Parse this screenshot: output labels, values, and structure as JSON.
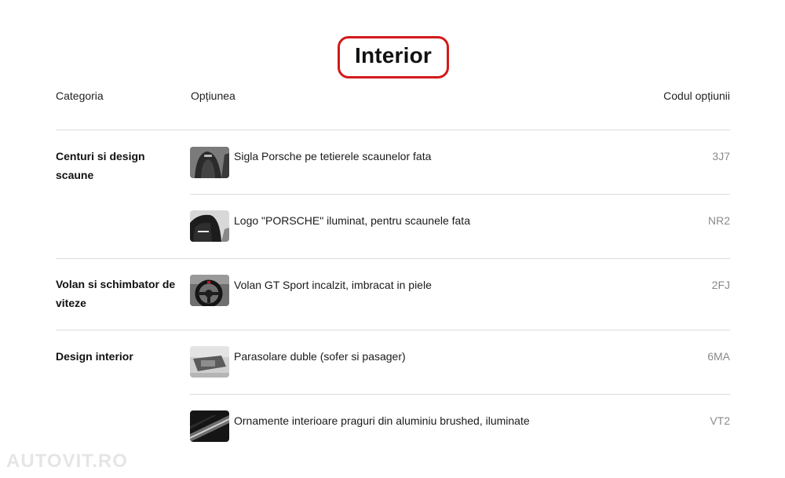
{
  "title": "Interior",
  "columns": {
    "category": "Categoria",
    "option": "Opțiunea",
    "code": "Codul opțiunii"
  },
  "rows": [
    {
      "category": "Centuri si design scaune",
      "option": "Sigla Porsche pe tetierele scaunelor fata",
      "code": "3J7",
      "thumb_icon": "headrest-logo-thumbnail"
    },
    {
      "category": "",
      "option": "Logo \"PORSCHE\" iluminat, pentru scaunele fata",
      "code": "NR2",
      "thumb_icon": "illuminated-seat-logo-thumbnail"
    },
    {
      "category": "Volan si schimbator de viteze",
      "option": "Volan GT Sport incalzit, imbracat in piele",
      "code": "2FJ",
      "thumb_icon": "steering-wheel-thumbnail"
    },
    {
      "category": "Design interior",
      "option": "Parasolare duble (sofer si pasager)",
      "code": "6MA",
      "thumb_icon": "sun-visor-thumbnail"
    },
    {
      "category": "",
      "option": "Ornamente interioare praguri din aluminiu brushed, iluminate",
      "code": "VT2",
      "thumb_icon": "door-sill-thumbnail"
    }
  ],
  "watermark": "AUTOVIT.RO",
  "colors": {
    "highlight": "#d21a1a",
    "divider": "#dcdcdc",
    "code_text": "#8a8a8a"
  }
}
